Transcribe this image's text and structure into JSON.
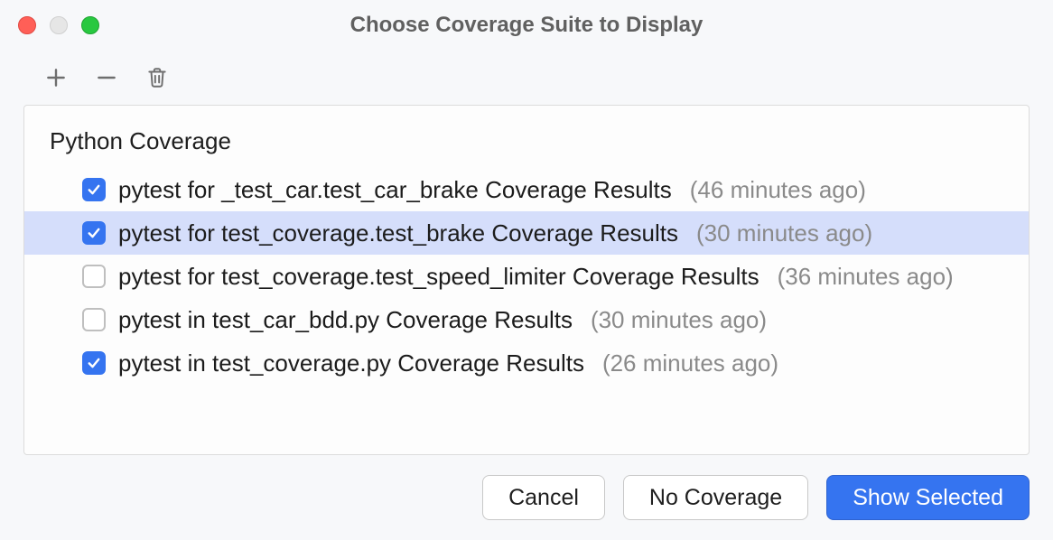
{
  "title": "Choose Coverage Suite to Display",
  "group": {
    "name": "Python Coverage"
  },
  "suites": [
    {
      "label": "pytest for _test_car.test_car_brake Coverage Results",
      "time": "(46 minutes ago)",
      "checked": true,
      "selected": false
    },
    {
      "label": "pytest for test_coverage.test_brake Coverage Results",
      "time": "(30 minutes ago)",
      "checked": true,
      "selected": true
    },
    {
      "label": "pytest for test_coverage.test_speed_limiter Coverage Results",
      "time": "(36 minutes ago)",
      "checked": false,
      "selected": false
    },
    {
      "label": "pytest in test_car_bdd.py Coverage Results",
      "time": "(30 minutes ago)",
      "checked": false,
      "selected": false
    },
    {
      "label": "pytest in test_coverage.py Coverage Results",
      "time": "(26 minutes ago)",
      "checked": true,
      "selected": false
    }
  ],
  "buttons": {
    "cancel": "Cancel",
    "no_coverage": "No Coverage",
    "show_selected": "Show Selected"
  }
}
